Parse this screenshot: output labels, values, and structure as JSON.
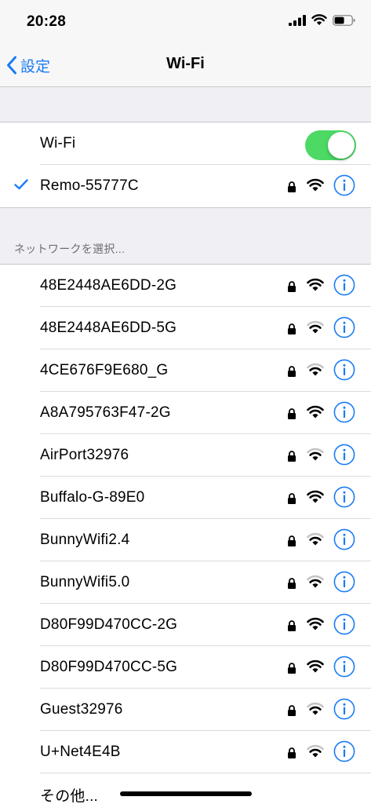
{
  "status_bar": {
    "time": "20:28"
  },
  "nav": {
    "back_label": "設定",
    "title": "Wi-Fi"
  },
  "wifi_toggle": {
    "label": "Wi-Fi",
    "on": true
  },
  "connected": {
    "name": "Remo-55777C",
    "locked": true,
    "signal": 3
  },
  "section_header": "ネットワークを選択...",
  "networks": [
    {
      "name": "48E2448AE6DD-2G",
      "locked": true,
      "signal": 3
    },
    {
      "name": "48E2448AE6DD-5G",
      "locked": true,
      "signal": 2
    },
    {
      "name": "4CE676F9E680_G",
      "locked": true,
      "signal": 2
    },
    {
      "name": "A8A795763F47-2G",
      "locked": true,
      "signal": 3
    },
    {
      "name": "AirPort32976",
      "locked": true,
      "signal": 2
    },
    {
      "name": "Buffalo-G-89E0",
      "locked": true,
      "signal": 3
    },
    {
      "name": "BunnyWifi2.4",
      "locked": true,
      "signal": 2
    },
    {
      "name": "BunnyWifi5.0",
      "locked": true,
      "signal": 2
    },
    {
      "name": "D80F99D470CC-2G",
      "locked": true,
      "signal": 3
    },
    {
      "name": "D80F99D470CC-5G",
      "locked": true,
      "signal": 3
    },
    {
      "name": "Guest32976",
      "locked": true,
      "signal": 2
    },
    {
      "name": "U+Net4E4B",
      "locked": true,
      "signal": 2
    }
  ],
  "other": {
    "label": "その他..."
  },
  "colors": {
    "accent": "#1a7cf5",
    "toggle_on": "#4cd964",
    "background": "#efeff4"
  },
  "icons": [
    "signal-bars-icon",
    "wifi-icon",
    "battery-icon",
    "back-chevron-icon",
    "checkmark-icon",
    "lock-icon",
    "info-icon"
  ]
}
